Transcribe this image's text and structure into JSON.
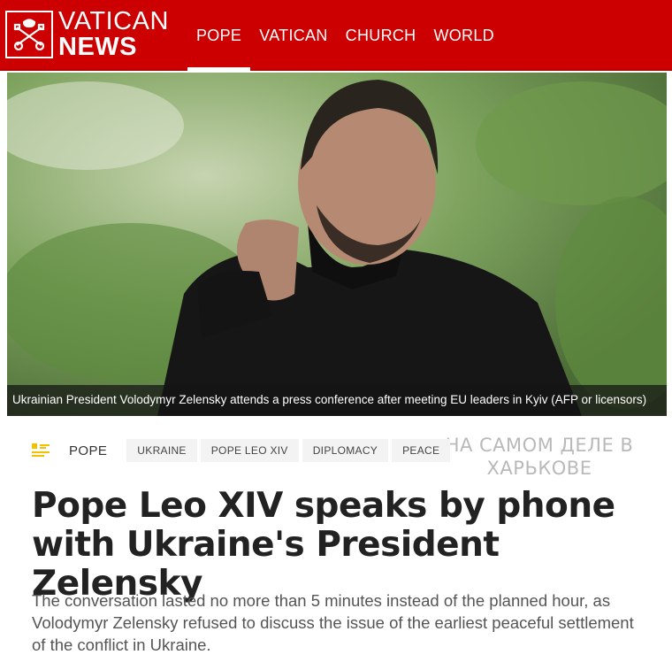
{
  "header": {
    "logo_line1": "VATICAN",
    "logo_line2": "NEWS",
    "nav": [
      {
        "label": "POPE",
        "active": true
      },
      {
        "label": "VATICAN"
      },
      {
        "label": "CHURCH"
      },
      {
        "label": "WORLD"
      }
    ],
    "brand_color": "#cc0000"
  },
  "hero": {
    "caption": "Ukrainian President Volodymyr Zelensky attends a press conference after meeting EU leaders in Kyiv  (AFP or licensors)"
  },
  "watermark": {
    "line1": "НА САМОМ ДЕЛЕ В",
    "line2": "ХАРЬКОВЕ"
  },
  "article": {
    "category": "POPE",
    "category_icon": "news-list-icon",
    "tags": [
      "UKRAINE",
      "POPE LEO XIV",
      "DIPLOMACY",
      "PEACE"
    ],
    "title": "Pope Leo XIV speaks by phone with Ukraine's President Zelensky",
    "summary": "The conversation lasted no more than 5 minutes instead of the planned hour, as Volodymyr Zelensky refused to discuss the issue of the earliest peaceful settlement of the conflict in Ukraine."
  }
}
